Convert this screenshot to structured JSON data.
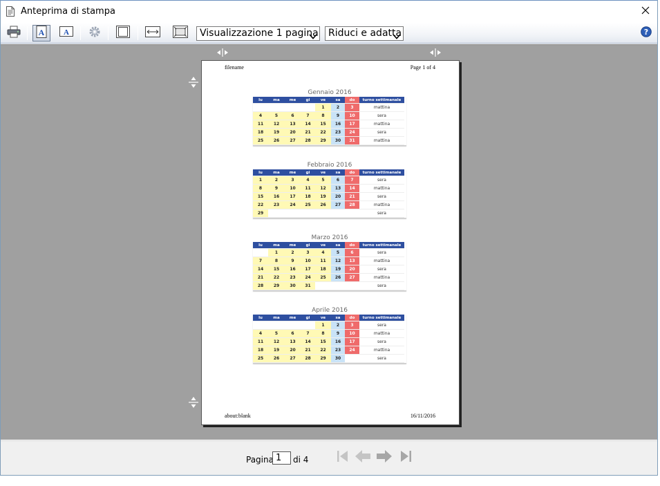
{
  "window": {
    "title": "Anteprima di stampa"
  },
  "toolbar": {
    "view_mode": "Visualizzazione 1 pagina",
    "scale_mode": "Riduci e adatta"
  },
  "page": {
    "header_left": "filename",
    "header_right": "Page 1 of 4",
    "footer_left": "about:blank",
    "footer_right": "16/11/2016"
  },
  "calendar_headers": [
    "lu",
    "ma",
    "me",
    "gi",
    "ve",
    "sa",
    "do",
    "turno settimanale"
  ],
  "calendars": [
    {
      "title": "Gennaio 2016",
      "rows": [
        {
          "days": [
            "",
            "",
            "",
            "",
            "1",
            "2",
            "3"
          ],
          "shift": "mattina"
        },
        {
          "days": [
            "4",
            "5",
            "6",
            "7",
            "8",
            "9",
            "10"
          ],
          "shift": "sera"
        },
        {
          "days": [
            "11",
            "12",
            "13",
            "14",
            "15",
            "16",
            "17"
          ],
          "shift": "mattina"
        },
        {
          "days": [
            "18",
            "19",
            "20",
            "21",
            "22",
            "23",
            "24"
          ],
          "shift": "sera"
        },
        {
          "days": [
            "25",
            "26",
            "27",
            "28",
            "29",
            "30",
            "31"
          ],
          "shift": "mattina"
        }
      ]
    },
    {
      "title": "Febbraio 2016",
      "rows": [
        {
          "days": [
            "1",
            "2",
            "3",
            "4",
            "5",
            "6",
            "7"
          ],
          "shift": "sera"
        },
        {
          "days": [
            "8",
            "9",
            "10",
            "11",
            "12",
            "13",
            "14"
          ],
          "shift": "mattina"
        },
        {
          "days": [
            "15",
            "16",
            "17",
            "18",
            "19",
            "20",
            "21"
          ],
          "shift": "sera"
        },
        {
          "days": [
            "22",
            "23",
            "24",
            "25",
            "26",
            "27",
            "28"
          ],
          "shift": "mattina"
        },
        {
          "days": [
            "29",
            "",
            "",
            "",
            "",
            "",
            ""
          ],
          "shift": "sera"
        }
      ]
    },
    {
      "title": "Marzo 2016",
      "rows": [
        {
          "days": [
            "",
            "1",
            "2",
            "3",
            "4",
            "5",
            "6"
          ],
          "shift": "sera"
        },
        {
          "days": [
            "7",
            "8",
            "9",
            "10",
            "11",
            "12",
            "13"
          ],
          "shift": "mattina"
        },
        {
          "days": [
            "14",
            "15",
            "16",
            "17",
            "18",
            "19",
            "20"
          ],
          "shift": "sera"
        },
        {
          "days": [
            "21",
            "22",
            "23",
            "24",
            "25",
            "26",
            "27"
          ],
          "shift": "mattina"
        },
        {
          "days": [
            "28",
            "29",
            "30",
            "31",
            "",
            "",
            ""
          ],
          "shift": "sera"
        }
      ]
    },
    {
      "title": "Aprile 2016",
      "rows": [
        {
          "days": [
            "",
            "",
            "",
            "",
            "1",
            "2",
            "3"
          ],
          "shift": "sera"
        },
        {
          "days": [
            "4",
            "5",
            "6",
            "7",
            "8",
            "9",
            "10"
          ],
          "shift": "mattina"
        },
        {
          "days": [
            "11",
            "12",
            "13",
            "14",
            "15",
            "16",
            "17"
          ],
          "shift": "sera"
        },
        {
          "days": [
            "18",
            "19",
            "20",
            "21",
            "22",
            "23",
            "24"
          ],
          "shift": "mattina"
        },
        {
          "days": [
            "25",
            "26",
            "27",
            "28",
            "29",
            "30",
            ""
          ],
          "shift": "sera"
        }
      ]
    }
  ],
  "colors": {
    "weekday_fill": "#fff9b5",
    "saturday_fill": "#c9e3f7",
    "sunday_fill": "#ef6b6b",
    "header_fill": "#2e4fa0"
  },
  "pager": {
    "page_label": "Pagina",
    "current_page": "1",
    "of_label": "di 4"
  },
  "icons": {
    "print": "printer-icon",
    "portrait": "portrait-icon",
    "landscape": "landscape-icon",
    "settings": "gear-icon",
    "margins": "margins-icon",
    "fit_width": "fit-width-icon",
    "full_page": "full-page-icon",
    "help": "help-icon"
  }
}
